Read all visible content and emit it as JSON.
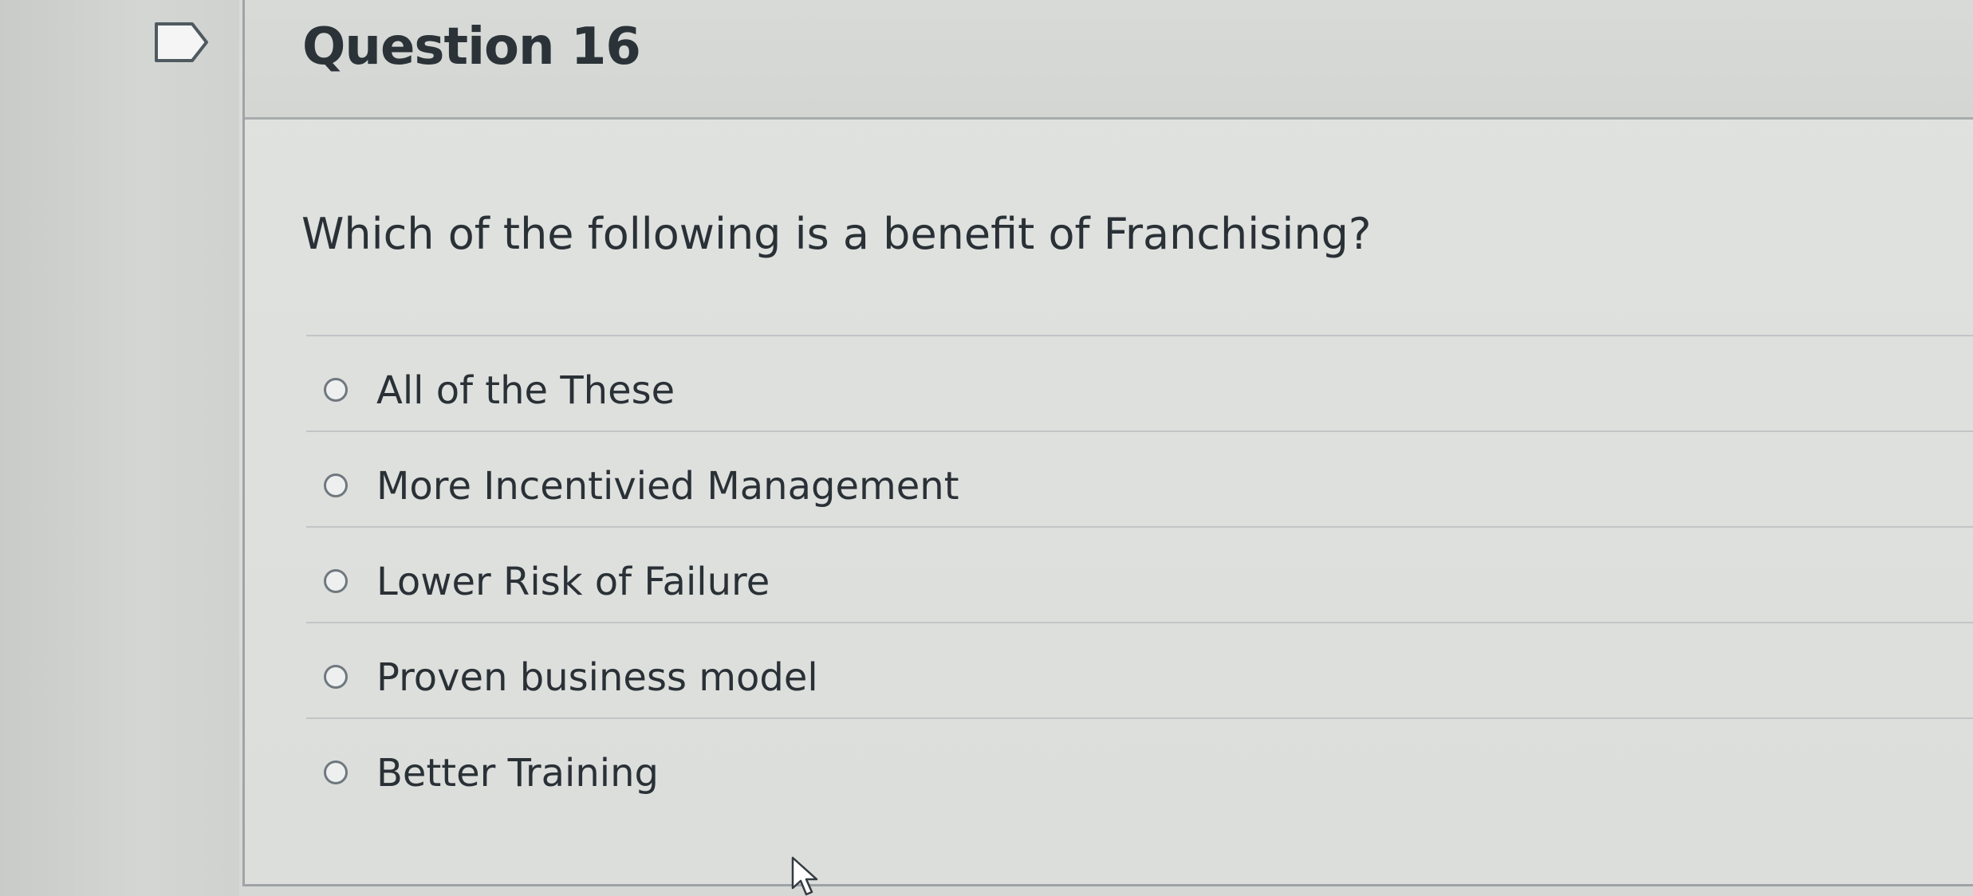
{
  "question": {
    "title": "Question 16",
    "text": "Which of the following is a benefit of Franchising?"
  },
  "answers": [
    {
      "label": "All of the These"
    },
    {
      "label": "More Incentivied Management"
    },
    {
      "label": "Lower Risk of Failure"
    },
    {
      "label": "Proven business model"
    },
    {
      "label": "Better Training"
    }
  ],
  "icons": {
    "flag": "flag-bookmark-icon",
    "cursor": "mouse-pointer-icon"
  },
  "colors": {
    "text": "#2a3136",
    "border": "#a8acad",
    "radio_border": "#6f787e"
  }
}
